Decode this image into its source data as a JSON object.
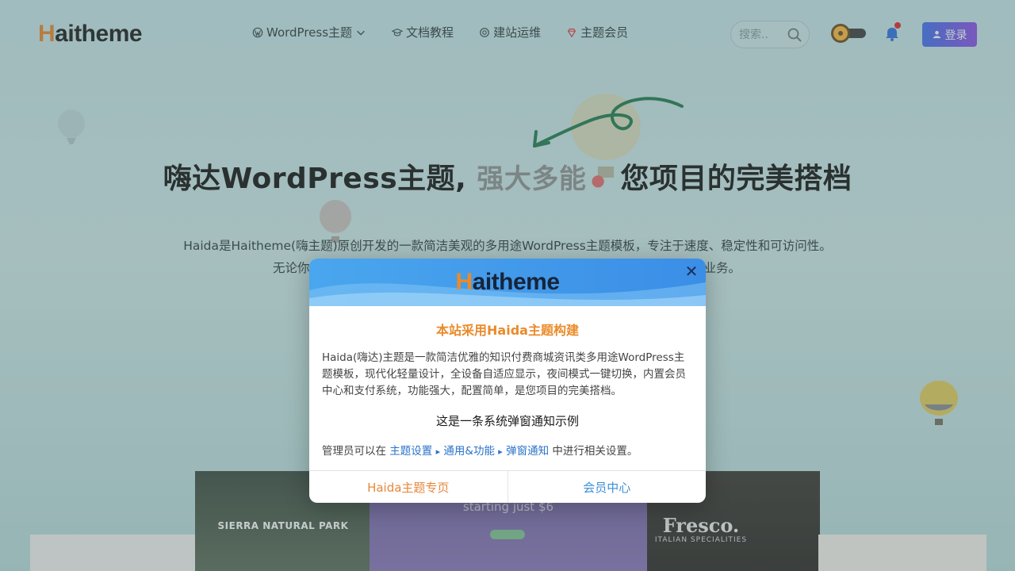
{
  "header": {
    "logo_first": "H",
    "logo_rest": "aitheme",
    "nav": [
      {
        "label": "WordPress主题",
        "icon": "wordpress-icon",
        "has_dropdown": true
      },
      {
        "label": "文档教程",
        "icon": "graduation-cap-icon"
      },
      {
        "label": "建站运维",
        "icon": "openai-icon"
      },
      {
        "label": "主题会员",
        "icon": "gem-icon"
      }
    ],
    "search_placeholder": "搜索..",
    "login_label": "登录"
  },
  "hero": {
    "title_left": "嗨达WordPress主题,",
    "title_rotating": "强大多能",
    "title_right": "您项目的完美搭档",
    "desc_line1": "Haida是Haitheme(嗨主题)原创开发的一款简洁美观的多用途WordPress主题模板，专注于速度、稳定性和可访问性。",
    "desc_line2_left": "无论你",
    "desc_line2_right": "业务。"
  },
  "shots": {
    "sierra": "SIERRA NATURAL PARK",
    "starting": "starting just $6",
    "fresco": "Fresco.",
    "fresco_sub": "ITALIAN SPECIALITIES"
  },
  "modal": {
    "logo_first": "H",
    "logo_rest": "aitheme",
    "title": "本站采用Haida主题构建",
    "body": "Haida(嗨达)主题是一款简洁优雅的知识付费商城资讯类多用途WordPress主题模板，现代化轻量设计，全设备自适应显示，夜间模式一键切换，内置会员中心和支付系统，功能强大，配置简单，是您项目的完美搭档。",
    "subtitle": "这是一条系统弹窗通知示例",
    "admin_prefix": "管理员可以在",
    "admin_link1": "主题设置",
    "admin_link2": "通用&功能",
    "admin_link3": "弹窗通知",
    "admin_suffix": "中进行相关设置。",
    "arrow": "▸",
    "btn_primary": "Haida主题专页",
    "btn_secondary": "会员中心"
  },
  "colors": {
    "accent_orange": "#ea8b2a",
    "link_blue": "#2a73c8",
    "modal_header_blue": "#4aa6ee"
  }
}
